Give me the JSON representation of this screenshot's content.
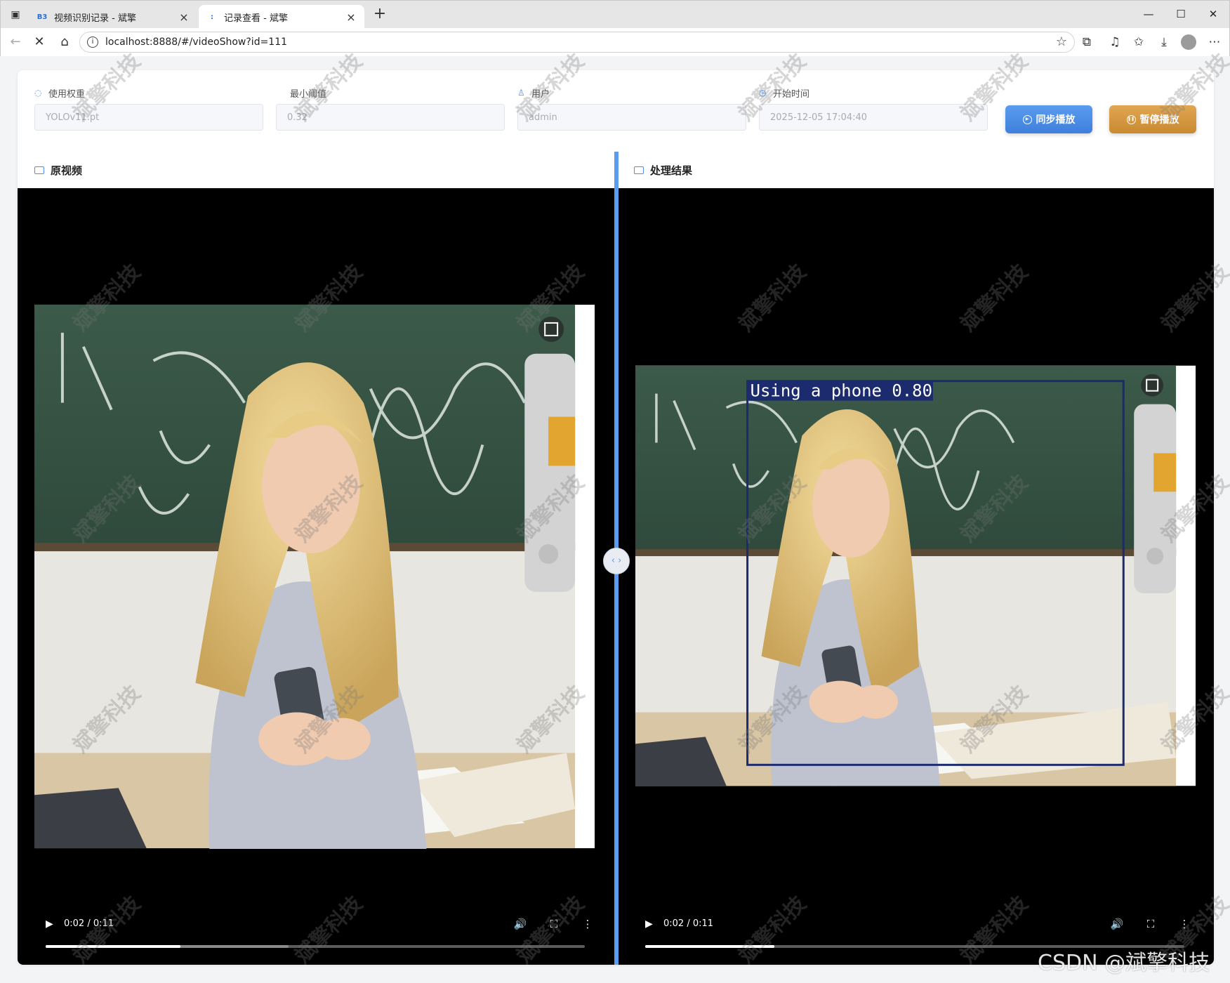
{
  "browser": {
    "tabs": [
      {
        "title": "视频识别记录 - 斌擎",
        "favicon": "B3"
      },
      {
        "title": "记录查看 - 斌擎",
        "favicon": ":"
      }
    ],
    "url": "localhost:8888/#/videoShow?id=111"
  },
  "form": {
    "weight_label": "使用权重",
    "weight_value": "YOLOv11.pt",
    "threshold_label": "最小阈值",
    "threshold_value": "0.32",
    "user_label": "用户",
    "user_value": "admin",
    "start_label": "开始时间",
    "start_value": "2025-12-05 17:04:40"
  },
  "buttons": {
    "sync": "同步播放",
    "pause": "暂停播放"
  },
  "panels": {
    "original_title": "原视频",
    "result_title": "处理结果"
  },
  "detection": {
    "label": "Using a phone 0.80",
    "box_color": "#1c2a6e"
  },
  "players": {
    "left": {
      "time": "0:02 / 0:11",
      "played": 0.25,
      "buffered": 0.45
    },
    "right": {
      "time": "0:02 / 0:11",
      "played": 0.24,
      "buffered": 0.24
    }
  },
  "watermark": {
    "text": "斌擎科技"
  },
  "footer_mark": "CSDN @斌擎科技",
  "colors": {
    "accent": "#5a9cf0",
    "sync_button": "#4a8ef0",
    "pause_button": "#d4973d",
    "video_bg": "#000000"
  }
}
